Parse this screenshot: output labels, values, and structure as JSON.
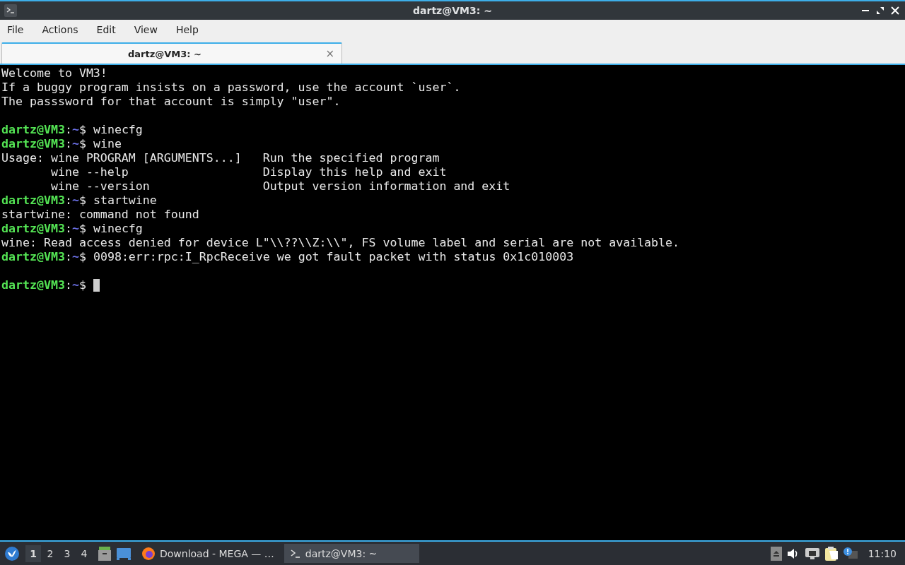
{
  "window": {
    "title": "dartz@VM3: ~"
  },
  "menu": [
    "File",
    "Actions",
    "Edit",
    "View",
    "Help"
  ],
  "tabs": [
    {
      "label": "dartz@VM3: ~",
      "selected": true,
      "close": "×"
    }
  ],
  "terminal": {
    "lines": [
      {
        "kind": "output",
        "text": "Welcome to VM3!"
      },
      {
        "kind": "output",
        "text": "If a buggy program insists on a password, use the account `user`."
      },
      {
        "kind": "output",
        "text": "The passsword for that account is simply \"user\"."
      },
      {
        "kind": "blank"
      },
      {
        "kind": "prompt",
        "user": "dartz@VM3",
        "separator": ":",
        "path": "~",
        "symbol": "$",
        "command": "winecfg"
      },
      {
        "kind": "prompt",
        "user": "dartz@VM3",
        "separator": ":",
        "path": "~",
        "symbol": "$",
        "command": "wine"
      },
      {
        "kind": "output",
        "text": "Usage: wine PROGRAM [ARGUMENTS...]   Run the specified program"
      },
      {
        "kind": "output",
        "text": "       wine --help                   Display this help and exit"
      },
      {
        "kind": "output",
        "text": "       wine --version                Output version information and exit"
      },
      {
        "kind": "prompt",
        "user": "dartz@VM3",
        "separator": ":",
        "path": "~",
        "symbol": "$",
        "command": "startwine"
      },
      {
        "kind": "output",
        "text": "startwine: command not found"
      },
      {
        "kind": "prompt",
        "user": "dartz@VM3",
        "separator": ":",
        "path": "~",
        "symbol": "$",
        "command": "winecfg"
      },
      {
        "kind": "output",
        "text": "wine: Read access denied for device L\"\\\\??\\\\Z:\\\\\", FS volume label and serial are not available."
      },
      {
        "kind": "prompt",
        "user": "dartz@VM3",
        "separator": ":",
        "path": "~",
        "symbol": "$",
        "command": "0098:err:rpc:I_RpcReceive we got fault packet with status 0x1c010003"
      },
      {
        "kind": "blank"
      },
      {
        "kind": "input",
        "user": "dartz@VM3",
        "separator": ":",
        "path": "~",
        "symbol": "$"
      }
    ]
  },
  "taskbar": {
    "desktops": [
      {
        "label": "1",
        "selected": true
      },
      {
        "label": "2",
        "selected": false
      },
      {
        "label": "3",
        "selected": false
      },
      {
        "label": "4",
        "selected": false
      }
    ],
    "tasks": [
      {
        "kind": "browser",
        "label": "Download - MEGA — …",
        "selected": false
      },
      {
        "kind": "terminal",
        "label": "dartz@VM3: ~",
        "selected": true
      }
    ],
    "clock": "11:10"
  }
}
